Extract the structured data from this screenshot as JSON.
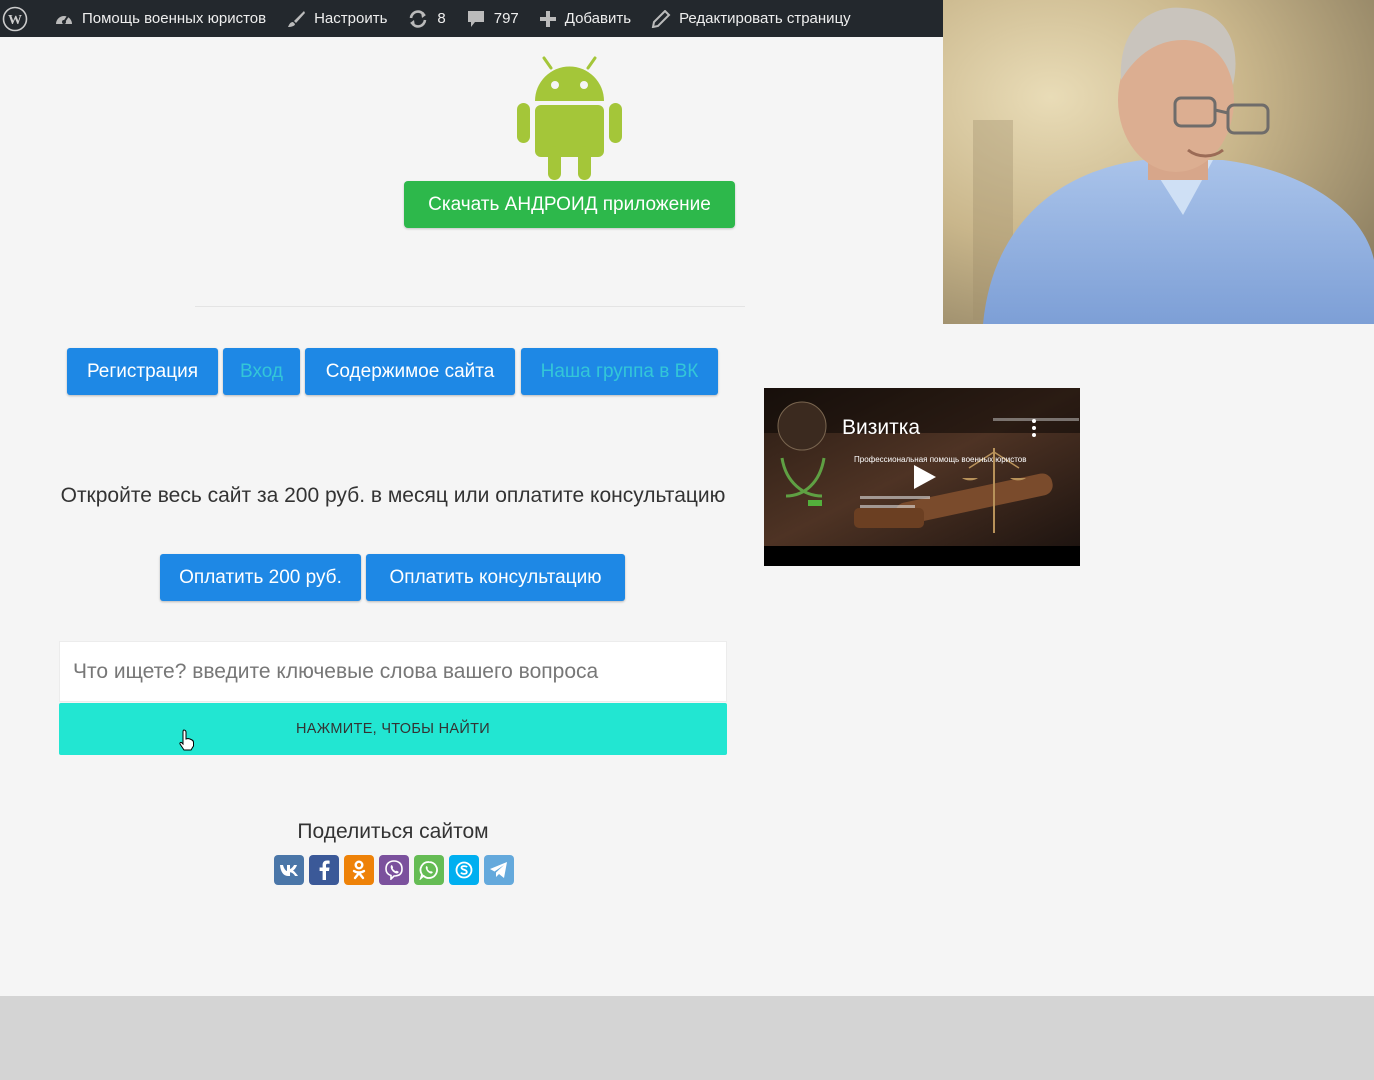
{
  "admin_bar": {
    "site_name": "Помощь военных юристов",
    "customize": "Настроить",
    "updates_count": "8",
    "comments_count": "797",
    "add_new": "Добавить",
    "edit_page": "Редактировать страницу"
  },
  "android": {
    "download_label": "Скачать АНДРОИД приложение"
  },
  "nav_buttons": [
    {
      "label": "Регистрация"
    },
    {
      "label": "Вход"
    },
    {
      "label": "Содержимое сайта"
    },
    {
      "label": "Наша группа в ВК"
    }
  ],
  "offer": {
    "text": "Откройте весь сайт за 200 руб. в месяц или оплатите консультацию",
    "pay_month": "Оплатить 200 руб.",
    "pay_consult": "Оплатить консультацию"
  },
  "search": {
    "placeholder": "Что ищете? введите ключевые слова вашего вопроса",
    "button": "НАЖМИТЕ, ЧТОБЫ НАЙТИ"
  },
  "share": {
    "title": "Поделиться сайтом",
    "networks": [
      "vk",
      "facebook",
      "odnoklassniki",
      "viber",
      "whatsapp",
      "skype",
      "telegram"
    ]
  },
  "video": {
    "title": "Визитка",
    "subtitle": "Профессиональная помощь военных юристов"
  },
  "colors": {
    "admin_bar": "#23282d",
    "green_button": "#2db84b",
    "blue_button": "#1e88e5",
    "search_button": "#22e6d2",
    "android": "#a4c639"
  }
}
